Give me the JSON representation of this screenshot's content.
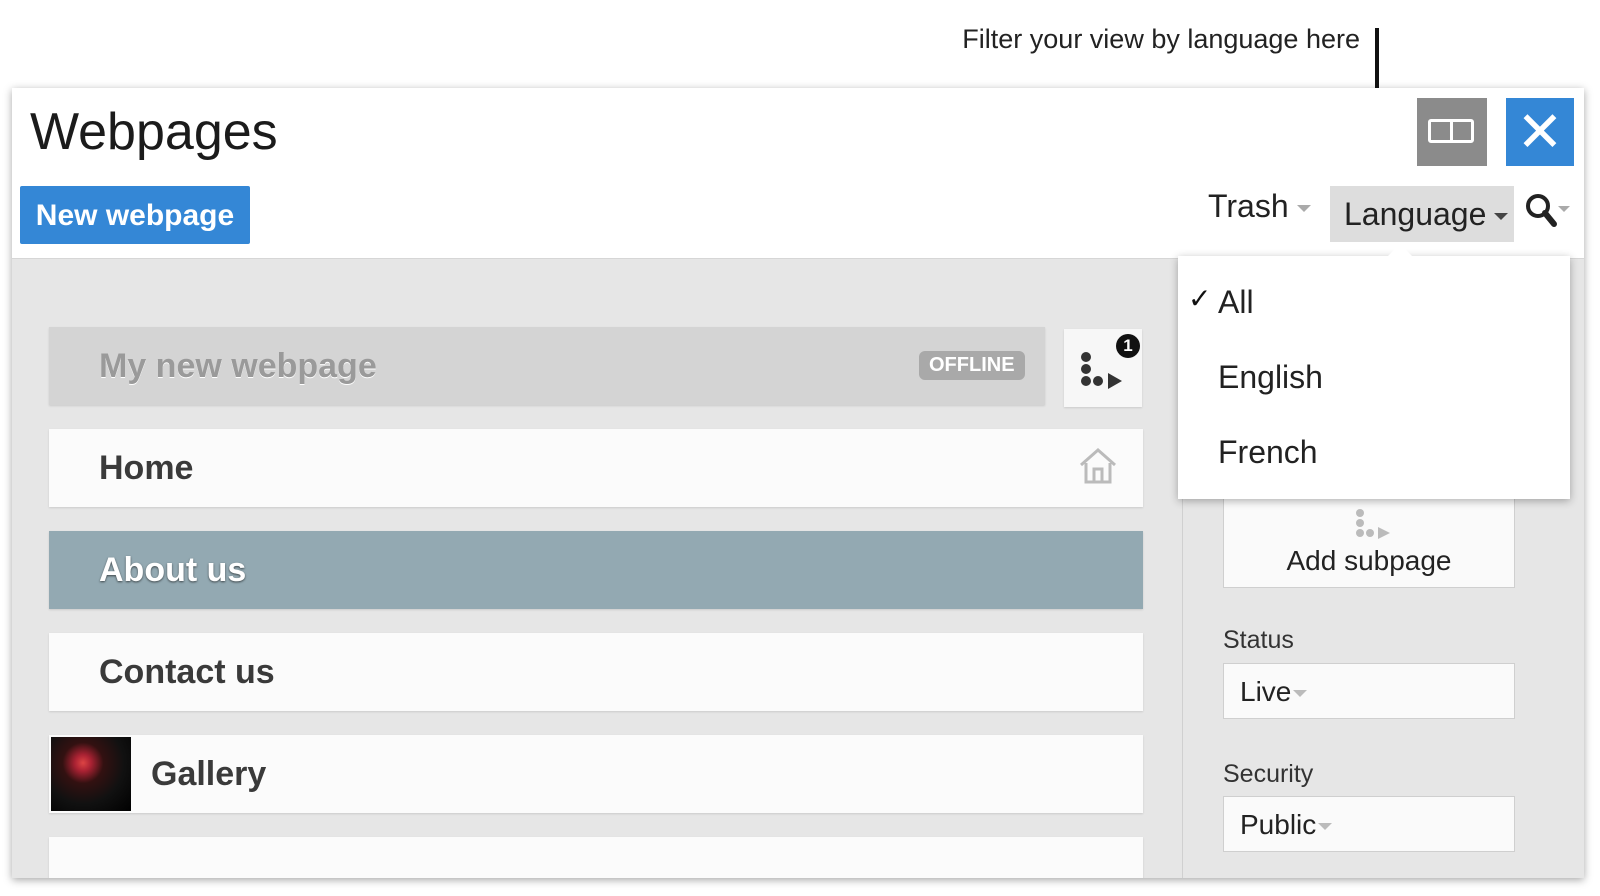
{
  "annotation": "Filter your view by language here",
  "header": {
    "title": "Webpages",
    "new_button": "New webpage",
    "close_glyph": "✕",
    "trash_label": "Trash",
    "language_label": "Language"
  },
  "pages": [
    {
      "label": "My new webpage",
      "badge": "OFFLINE",
      "state": "offline"
    },
    {
      "label": "Home",
      "icon": "home-icon"
    },
    {
      "label": "About us",
      "state": "selected"
    },
    {
      "label": "Contact us"
    },
    {
      "label": "Gallery",
      "icon": "gallery-thumbnail"
    }
  ],
  "subpage_count": "1",
  "sidebar": {
    "add_subpage": "Add subpage",
    "status_label": "Status",
    "status_value": "Live",
    "security_label": "Security",
    "security_value": "Public"
  },
  "language_menu": {
    "check_glyph": "✓",
    "options": [
      "All",
      "English",
      "French"
    ],
    "selected": "All"
  },
  "colors": {
    "accent": "#3487d6",
    "selected_row": "#93a9b2",
    "offline_row": "#d4d4d4"
  }
}
